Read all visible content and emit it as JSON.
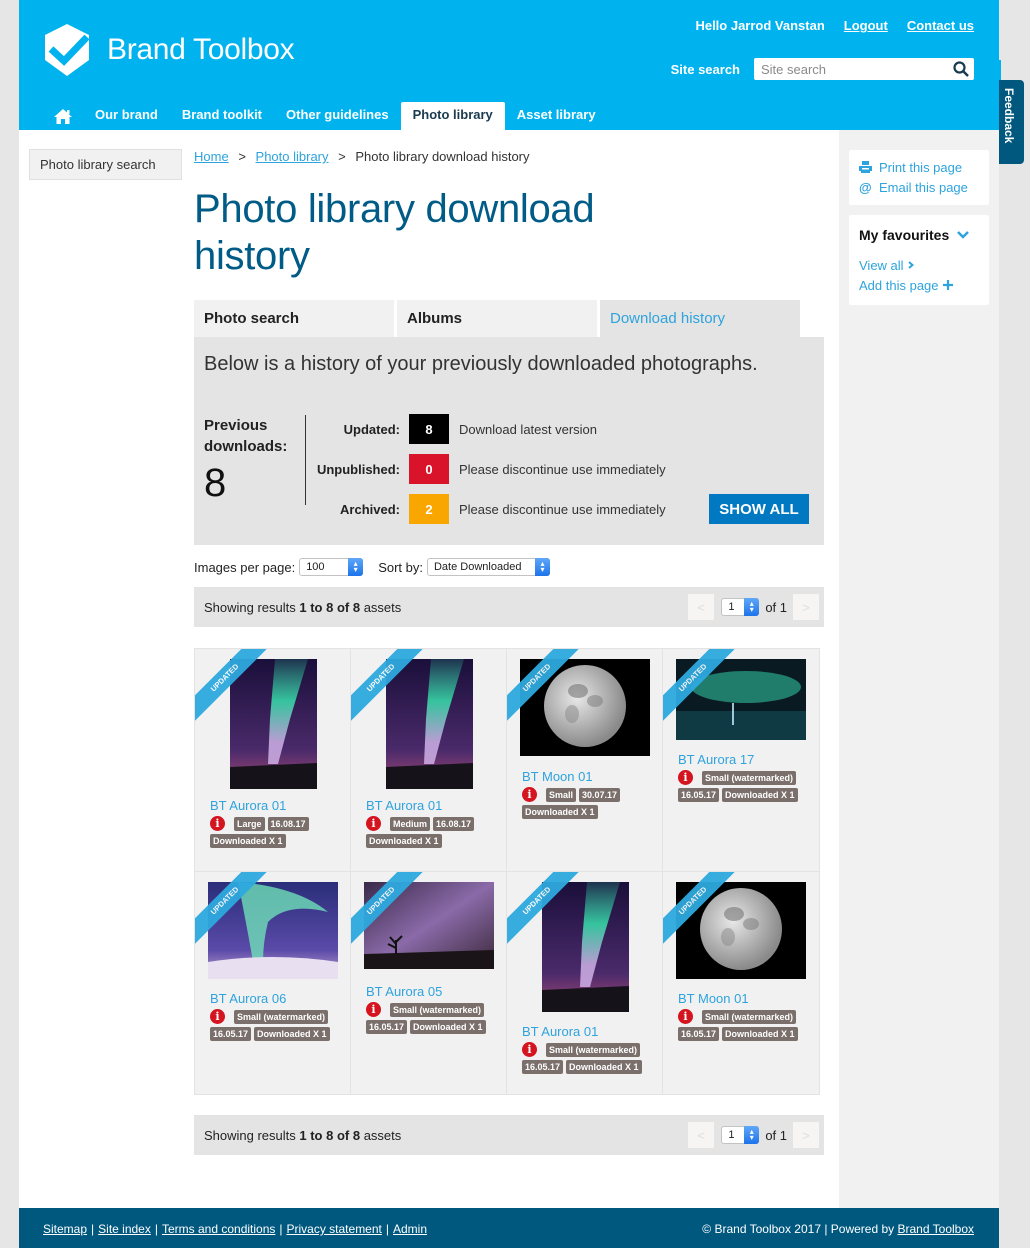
{
  "header": {
    "logo_text": "Brand Toolbox",
    "greeting": "Hello Jarrod Vanstan",
    "logout": "Logout",
    "contact": "Contact us",
    "search_label": "Site search",
    "search_placeholder": "Site search",
    "search_value": ""
  },
  "nav": {
    "home_icon": "home-icon",
    "items": [
      {
        "label": "Our brand",
        "active": false
      },
      {
        "label": "Brand toolkit",
        "active": false
      },
      {
        "label": "Other guidelines",
        "active": false
      },
      {
        "label": "Photo library",
        "active": true
      },
      {
        "label": "Asset library",
        "active": false
      }
    ]
  },
  "feedback_tab": "Feedback",
  "left_nav": {
    "item": "Photo library search"
  },
  "breadcrumb": {
    "items": [
      {
        "label": "Home",
        "link": true
      },
      {
        "label": "Photo library",
        "link": true
      },
      {
        "label": "Photo library download history",
        "link": false
      }
    ],
    "separator": ">"
  },
  "page_title": "Photo library download history",
  "tabs": [
    {
      "label": "Photo search",
      "active": false
    },
    {
      "label": "Albums",
      "active": false
    },
    {
      "label": "Download history",
      "active": true
    }
  ],
  "summary": {
    "intro": "Below is a history of your previously downloaded photographs.",
    "previous_label": "Previous downloads:",
    "previous_count": "8",
    "statuses": [
      {
        "label": "Updated:",
        "count": "8",
        "color": "#000000",
        "desc": "Download latest version"
      },
      {
        "label": "Unpublished:",
        "count": "0",
        "color": "#d9142a",
        "desc": "Please discontinue use immediately"
      },
      {
        "label": "Archived:",
        "count": "2",
        "color": "#f9a600",
        "desc": "Please discontinue use immediately"
      }
    ],
    "show_all": "SHOW ALL"
  },
  "controls": {
    "per_page_label": "Images per page:",
    "per_page_value": "100",
    "sort_label": "Sort by:",
    "sort_value": "Date Downloaded"
  },
  "results": {
    "prefix": "Showing results ",
    "range": "1 to 8 of 8",
    "suffix": " assets",
    "page_value": "1",
    "of_label": "of 1",
    "prev": "<",
    "next": ">"
  },
  "assets": [
    {
      "title": "BT Aurora 01",
      "ribbon": "UPDATED",
      "image": "aurora-portrait",
      "tags": [
        "Large",
        "16.08.17",
        "Downloaded X 1"
      ]
    },
    {
      "title": "BT Aurora 01",
      "ribbon": "UPDATED",
      "image": "aurora-portrait",
      "tags": [
        "Medium",
        "16.08.17",
        "Downloaded X 1"
      ]
    },
    {
      "title": "BT Moon 01",
      "ribbon": "UPDATED",
      "image": "moon",
      "tags": [
        "Small",
        "30.07.17",
        "Downloaded X 1"
      ]
    },
    {
      "title": "BT Aurora 17",
      "ribbon": "UPDATED",
      "image": "aurora-lake",
      "tags": [
        "Small (watermarked)",
        "16.05.17",
        "Downloaded X 1"
      ]
    },
    {
      "title": "BT Aurora 06",
      "ribbon": "UPDATED",
      "image": "aurora-snow",
      "tags": [
        "Small (watermarked)",
        "16.05.17",
        "Downloaded X 1"
      ]
    },
    {
      "title": "BT Aurora 05",
      "ribbon": "UPDATED",
      "image": "aurora-tree",
      "tags": [
        "Small (watermarked)",
        "16.05.17",
        "Downloaded X 1"
      ]
    },
    {
      "title": "BT Aurora 01",
      "ribbon": "UPDATED",
      "image": "aurora-portrait",
      "tags": [
        "Small (watermarked)",
        "16.05.17",
        "Downloaded X 1"
      ]
    },
    {
      "title": "BT Moon 01",
      "ribbon": "UPDATED",
      "image": "moon",
      "tags": [
        "Small (watermarked)",
        "16.05.17",
        "Downloaded X 1"
      ]
    }
  ],
  "right_sidebar": {
    "print": "Print this page",
    "email": "Email this page",
    "favourites_title": "My favourites",
    "view_all": "View all",
    "add_page": "Add this page"
  },
  "footer": {
    "links": [
      "Sitemap",
      "Site index",
      "Terms and conditions",
      "Privacy statement",
      "Admin"
    ],
    "copyright": "© Brand Toolbox 2017 | Powered by ",
    "powered_link": "Brand Toolbox"
  },
  "colors": {
    "brand": "#00b3ee",
    "dark": "#00587f",
    "title": "#005b86",
    "link": "#2ea3dd",
    "button": "#0079c2"
  }
}
